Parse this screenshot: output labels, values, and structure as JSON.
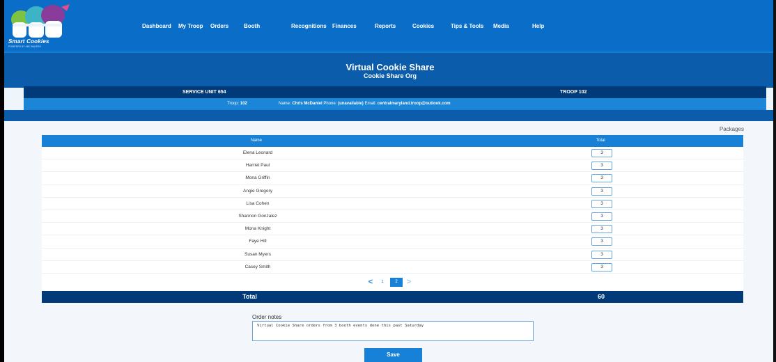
{
  "brand": {
    "logo_text": "Smart Cookies",
    "logo_sub": "POWERED BY ABC BAKERS",
    "colors": {
      "nav": "#0a6ec9",
      "dark": "#003a78",
      "accent": "#1781d8"
    }
  },
  "nav": [
    "Dashboard",
    "My Troop",
    "Orders",
    "Booth",
    "Recognitions",
    "Finances",
    "Reports",
    "Cookies",
    "Tips & Tools",
    "Media",
    "Help"
  ],
  "header": {
    "title": "Virtual Cookie Share",
    "subtitle": "Cookie Share Org"
  },
  "unit": {
    "service_unit": "SERVICE UNIT 654",
    "troop": "TROOP 102"
  },
  "info": {
    "troop_label": "Troop:",
    "troop_value": "102",
    "name_label": "Name:",
    "name_value": "Chris McDaniel",
    "phone_label": "Phone:",
    "phone_value": "(unavailable)",
    "email_label": "Email:",
    "email_value": "centralmaryland.troop@outlook.com"
  },
  "table": {
    "packages_label": "Packages",
    "col_name": "Name",
    "col_total": "Total",
    "rows": [
      {
        "name": "Elena Leonard",
        "qty": "3"
      },
      {
        "name": "Harriet Paul",
        "qty": "3"
      },
      {
        "name": "Mona Griffin",
        "qty": "3"
      },
      {
        "name": "Angie Gregory",
        "qty": "3"
      },
      {
        "name": "Lisa Cohen",
        "qty": "3"
      },
      {
        "name": "Shannon Gonzalez",
        "qty": "3"
      },
      {
        "name": "Mona Knight",
        "qty": "3"
      },
      {
        "name": "Faye Hill",
        "qty": "3"
      },
      {
        "name": "Susan Myers",
        "qty": "3"
      },
      {
        "name": "Casey Smith",
        "qty": "3"
      }
    ],
    "pager": {
      "prev": "<",
      "pages": [
        "1",
        "2"
      ],
      "current": "2",
      "next": ">"
    },
    "total_label": "Total",
    "total_value": "60"
  },
  "notes": {
    "label": "Order notes",
    "value": "Virtual Cookie Share orders from 3 booth events done this past Saturday"
  },
  "save_label": "Save"
}
